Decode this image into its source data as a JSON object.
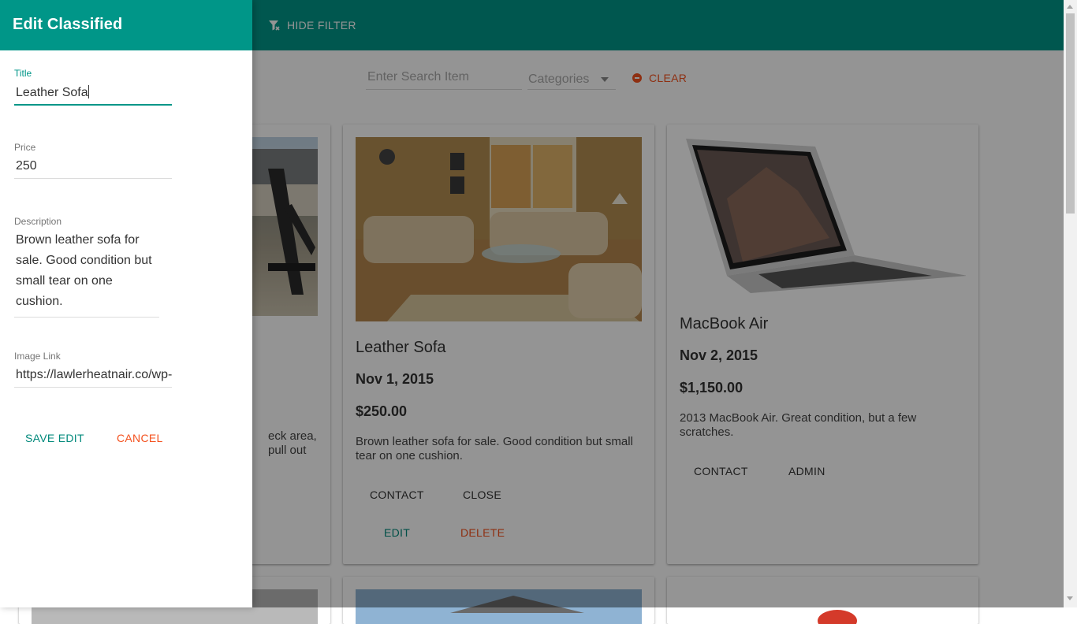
{
  "toolbar": {
    "hide_filter_label": "HIDE FILTER"
  },
  "filter": {
    "search_placeholder": "Enter Search Item",
    "categories_label": "Categories",
    "clear_label": "CLEAR"
  },
  "cards": [
    {
      "partial_desc_line1": "eck area,",
      "partial_desc_line2": "pull out"
    },
    {
      "title": "Leather Sofa",
      "date": "Nov 1, 2015",
      "price": "$250.00",
      "description": "Brown leather sofa for sale. Good condition but small tear on one cushion.",
      "buttons": {
        "contact": "CONTACT",
        "close": "CLOSE",
        "edit": "EDIT",
        "delete": "DELETE"
      }
    },
    {
      "title": "MacBook Air",
      "date": "Nov 2, 2015",
      "price": "$1,150.00",
      "description": "2013 MacBook Air. Great condition, but a few scratches.",
      "buttons": {
        "contact": "CONTACT",
        "admin": "ADMIN"
      }
    }
  ],
  "drawer": {
    "title": "Edit Classified",
    "fields": {
      "title": {
        "label": "Title",
        "value": "Leather Sofa"
      },
      "price": {
        "label": "Price",
        "value": "250"
      },
      "description": {
        "label": "Description",
        "value": "Brown leather sofa for sale.  Good condition but small tear on one cushion."
      },
      "image_link": {
        "label": "Image Link",
        "value": "https://lawlerheatnair.co/wp-"
      }
    },
    "save_label": "SAVE EDIT",
    "cancel_label": "CANCEL"
  },
  "colors": {
    "primary": "#009688",
    "accent": "#f4511e",
    "overlay": "rgba(0,0,0,0.42)"
  },
  "icons": {
    "hide_filter": "filter-off-icon",
    "clear": "remove-circle-icon"
  }
}
